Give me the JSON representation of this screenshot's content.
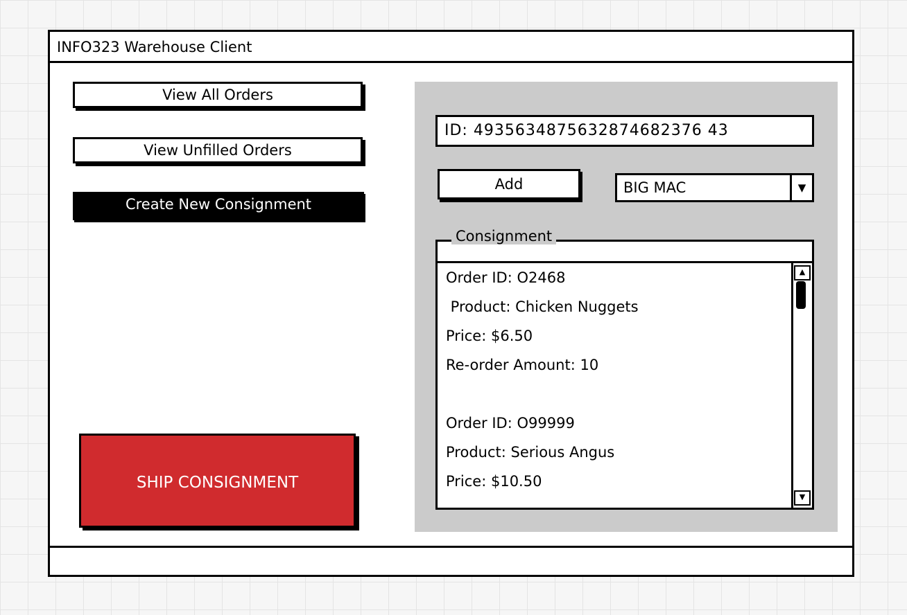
{
  "window": {
    "title": "INFO323 Warehouse Client"
  },
  "sidebar": {
    "view_all_orders": "View All Orders",
    "view_unfilled_orders": "View Unfilled Orders",
    "create_new_consignment": "Create New Consignment",
    "ship_consignment": "SHIP CONSIGNMENT"
  },
  "panel": {
    "id_field_value": "ID: 4935634875632874682376 43",
    "add_label": "Add",
    "product_select_value": "BIG MAC",
    "group_caption": "Consignment",
    "list_lines": [
      "Order ID: O2468",
      " Product: Chicken Nuggets",
      "Price: $6.50",
      "Re-order Amount: 10",
      "",
      "Order ID: O99999",
      "Product: Serious Angus",
      "Price: $10.50"
    ]
  },
  "icons": {
    "dropdown": "triangle-down",
    "scroll_up": "triangle-up",
    "scroll_down": "triangle-down"
  },
  "colors": {
    "ship_button": "#d02b2e",
    "panel_background": "#cbcbcb",
    "dark_button": "#000000"
  }
}
